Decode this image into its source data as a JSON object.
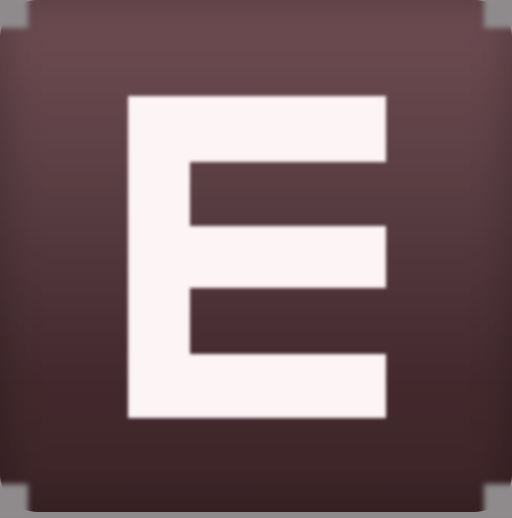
{
  "app_icon": {
    "letter": "E",
    "background_top_color": "#6e4d53",
    "background_bottom_color": "#3b2427",
    "letter_color": "#fdf4f6",
    "icon_name": "letter-e-icon"
  }
}
